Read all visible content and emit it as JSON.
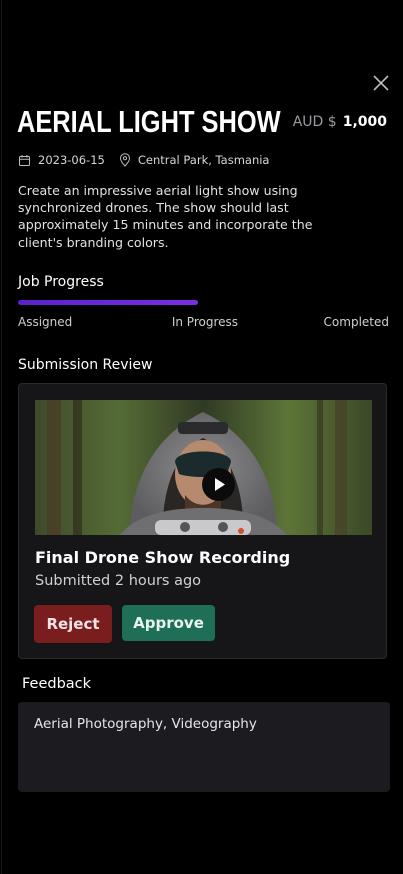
{
  "job": {
    "title": "AERIAL LIGHT SHOW",
    "currency": "AUD $",
    "amount": "1,000",
    "date": "2023-06-15",
    "location": "Central Park, Tasmania",
    "description": "Create an impressive aerial light show using synchronized drones. The show should last approximately 15 minutes and incorporate the client's branding colors."
  },
  "progress": {
    "label": "Job Progress",
    "steps": [
      "Assigned",
      "In Progress",
      "Completed"
    ],
    "value_fraction": 0.48,
    "color": "#6a28d9"
  },
  "submission": {
    "section_label": "Submission Review",
    "title": "Final Drone Show Recording",
    "subtitle": "Submitted 2 hours ago",
    "reject_label": "Reject",
    "approve_label": "Approve",
    "reject_color": "#7a1d1f",
    "approve_color": "#1f6e57"
  },
  "feedback": {
    "label": "Feedback",
    "value": "Aerial Photography, Videography"
  },
  "icons": {
    "close": "close-icon",
    "calendar": "calendar-icon",
    "location": "location-pin-icon",
    "play": "play-icon"
  }
}
